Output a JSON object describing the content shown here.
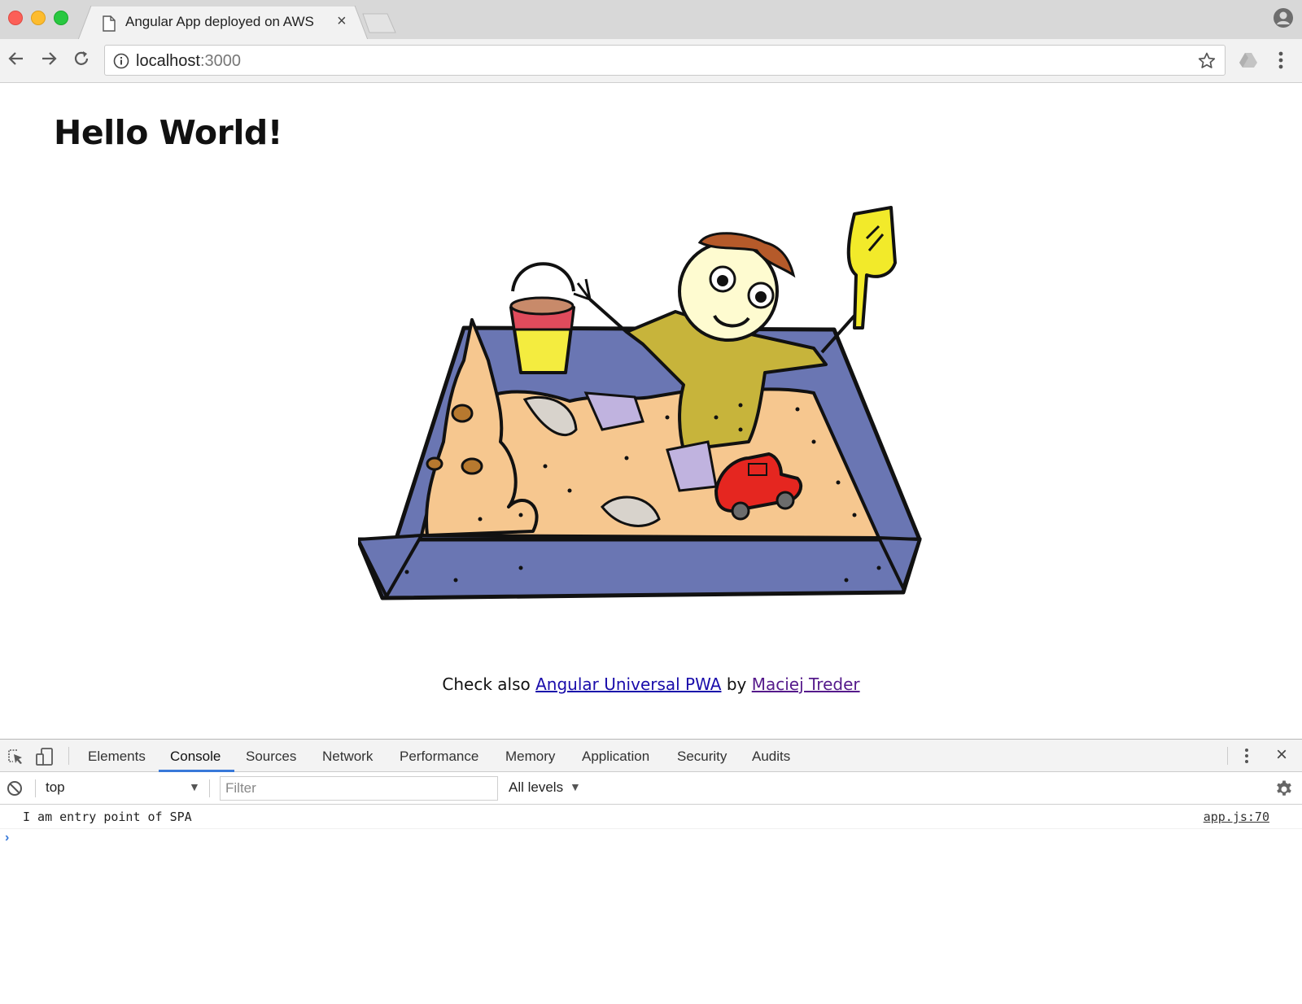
{
  "browser": {
    "tab_title": "Angular App deployed on AWS",
    "url_host": "localhost",
    "url_port": ":3000"
  },
  "page": {
    "heading": "Hello World!",
    "illustration_name": "sandbox-illustration",
    "footer": {
      "prefix": "Check also ",
      "link1": "Angular Universal PWA",
      "middle": " by ",
      "link2": "Maciej Treder"
    }
  },
  "devtools": {
    "tabs": [
      "Elements",
      "Console",
      "Sources",
      "Network",
      "Performance",
      "Memory",
      "Application",
      "Security",
      "Audits"
    ],
    "active_tab": "Console",
    "context": "top",
    "filter_placeholder": "Filter",
    "levels": "All levels",
    "messages": [
      {
        "text": "I am entry point of SPA",
        "source": "app.js:70"
      }
    ]
  },
  "colors": {
    "accent": "#3879d9",
    "link": "#1a0dab",
    "link_visited": "#551a8b",
    "sandbox_frame": "#6a76b3",
    "sand": "#f6c78f",
    "shirt": "#c7b43b",
    "shovel": "#f2ea2a",
    "car": "#e52620"
  }
}
